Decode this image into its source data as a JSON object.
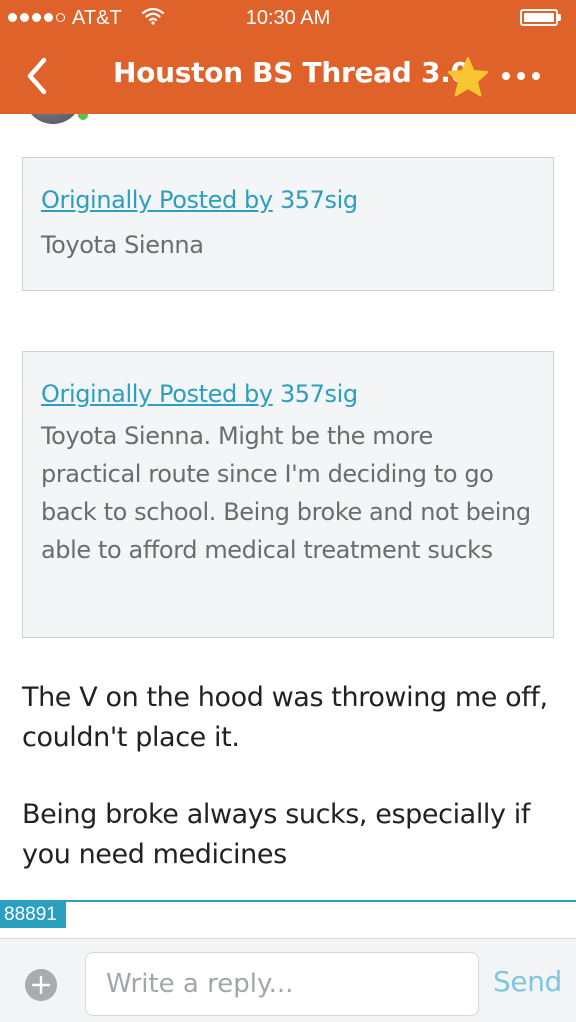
{
  "status_bar": {
    "carrier": "AT&T",
    "time": "10:30 AM",
    "signal_bars_filled": 4,
    "signal_bars_total": 5,
    "battery_level": 1.0
  },
  "nav": {
    "title": "Houston BS Thread 3.0",
    "back_icon": "chevron-left-icon",
    "favorite_icon": "star-icon",
    "more_icon": "more-dots-icon"
  },
  "post": {
    "quotes": [
      {
        "prefix": "Originally Posted by",
        "author": "357sig",
        "text": "Toyota Sienna"
      },
      {
        "prefix": "Originally Posted by",
        "author": "357sig",
        "text": "Toyota Sienna. Might be the more practical route since I'm deciding to go back to school. Being broke and not being able to afford medical treatment sucks"
      }
    ],
    "paragraphs": [
      "The V on the hood was throwing me off, couldn't place it.",
      "Being broke always sucks, especially if you need medicines"
    ],
    "post_id": "88891"
  },
  "reply_bar": {
    "placeholder": "Write a reply...",
    "send_label": "Send",
    "add_icon": "plus-circle-icon"
  },
  "colors": {
    "header": "#e0622b",
    "accent": "#2a9fbf",
    "star": "#f6c531",
    "send": "#7fc7df"
  }
}
